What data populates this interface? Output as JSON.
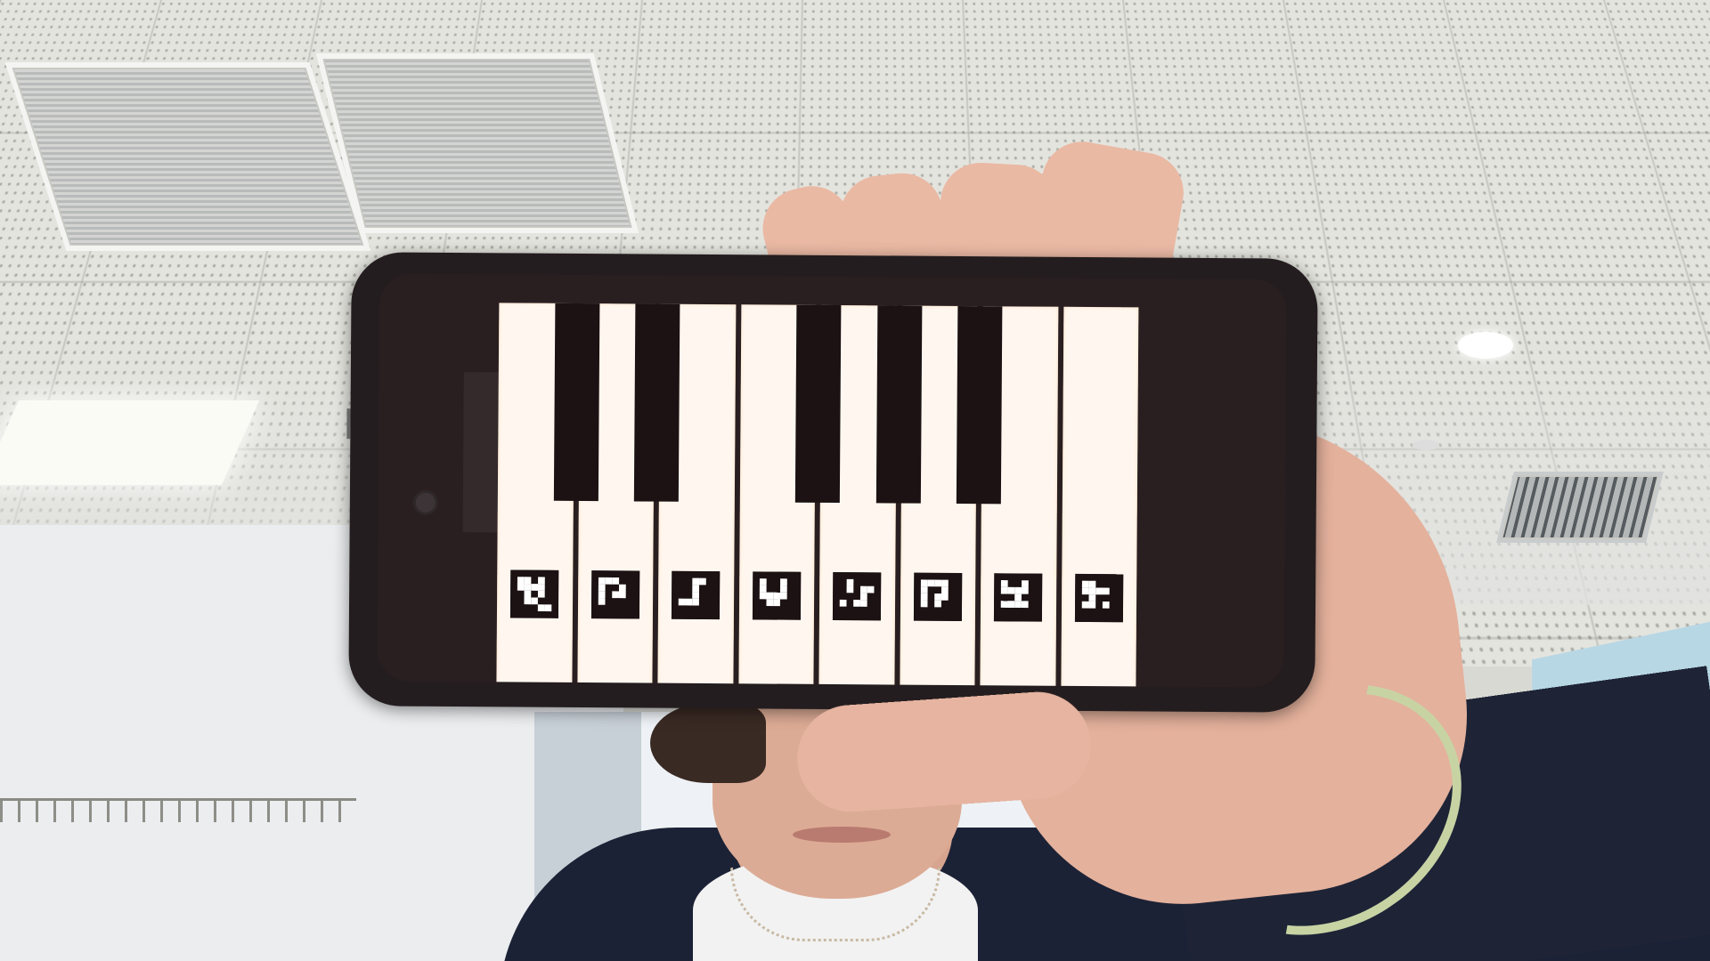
{
  "scene": {
    "description_free": true
  },
  "phone_app": {
    "type": "piano-keyboard",
    "white_keys": [
      {
        "id": "key-1",
        "marker": "aruco-1"
      },
      {
        "id": "key-2",
        "marker": "aruco-2"
      },
      {
        "id": "key-3",
        "marker": "aruco-3"
      },
      {
        "id": "key-4",
        "marker": "aruco-4"
      },
      {
        "id": "key-5",
        "marker": "aruco-5"
      },
      {
        "id": "key-6",
        "marker": "aruco-6"
      },
      {
        "id": "key-7",
        "marker": "aruco-7"
      },
      {
        "id": "key-8",
        "marker": "aruco-8"
      }
    ],
    "black_key_after_white": [
      1,
      2,
      4,
      5,
      6
    ],
    "colors": {
      "white_key": "#fff7ef",
      "black_key": "#1c1213",
      "phone_body": "#241d1f"
    }
  }
}
